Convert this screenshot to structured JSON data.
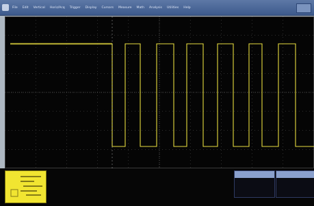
{
  "menubar": {
    "items": [
      "File",
      "Edit",
      "Vertical",
      "Horiz/Acq",
      "Trigger",
      "Display",
      "Cursors",
      "Measure",
      "Math",
      "Analysis",
      "Utilities",
      "Help"
    ]
  },
  "overview": {
    "label": ""
  },
  "measurements": {
    "box1": {
      "header": "",
      "rows": [
        "",
        ""
      ]
    },
    "box2": {
      "header": "",
      "rows": [
        "",
        ""
      ]
    }
  },
  "status": {
    "left_text": ""
  },
  "colors": {
    "trace": "#e7dc3e",
    "grid": "#6f6f6f",
    "menubar": "#3d5a8c",
    "overview": "#f1e531"
  },
  "icons": [
    "system-menu-icon",
    "window-button-icon"
  ]
}
